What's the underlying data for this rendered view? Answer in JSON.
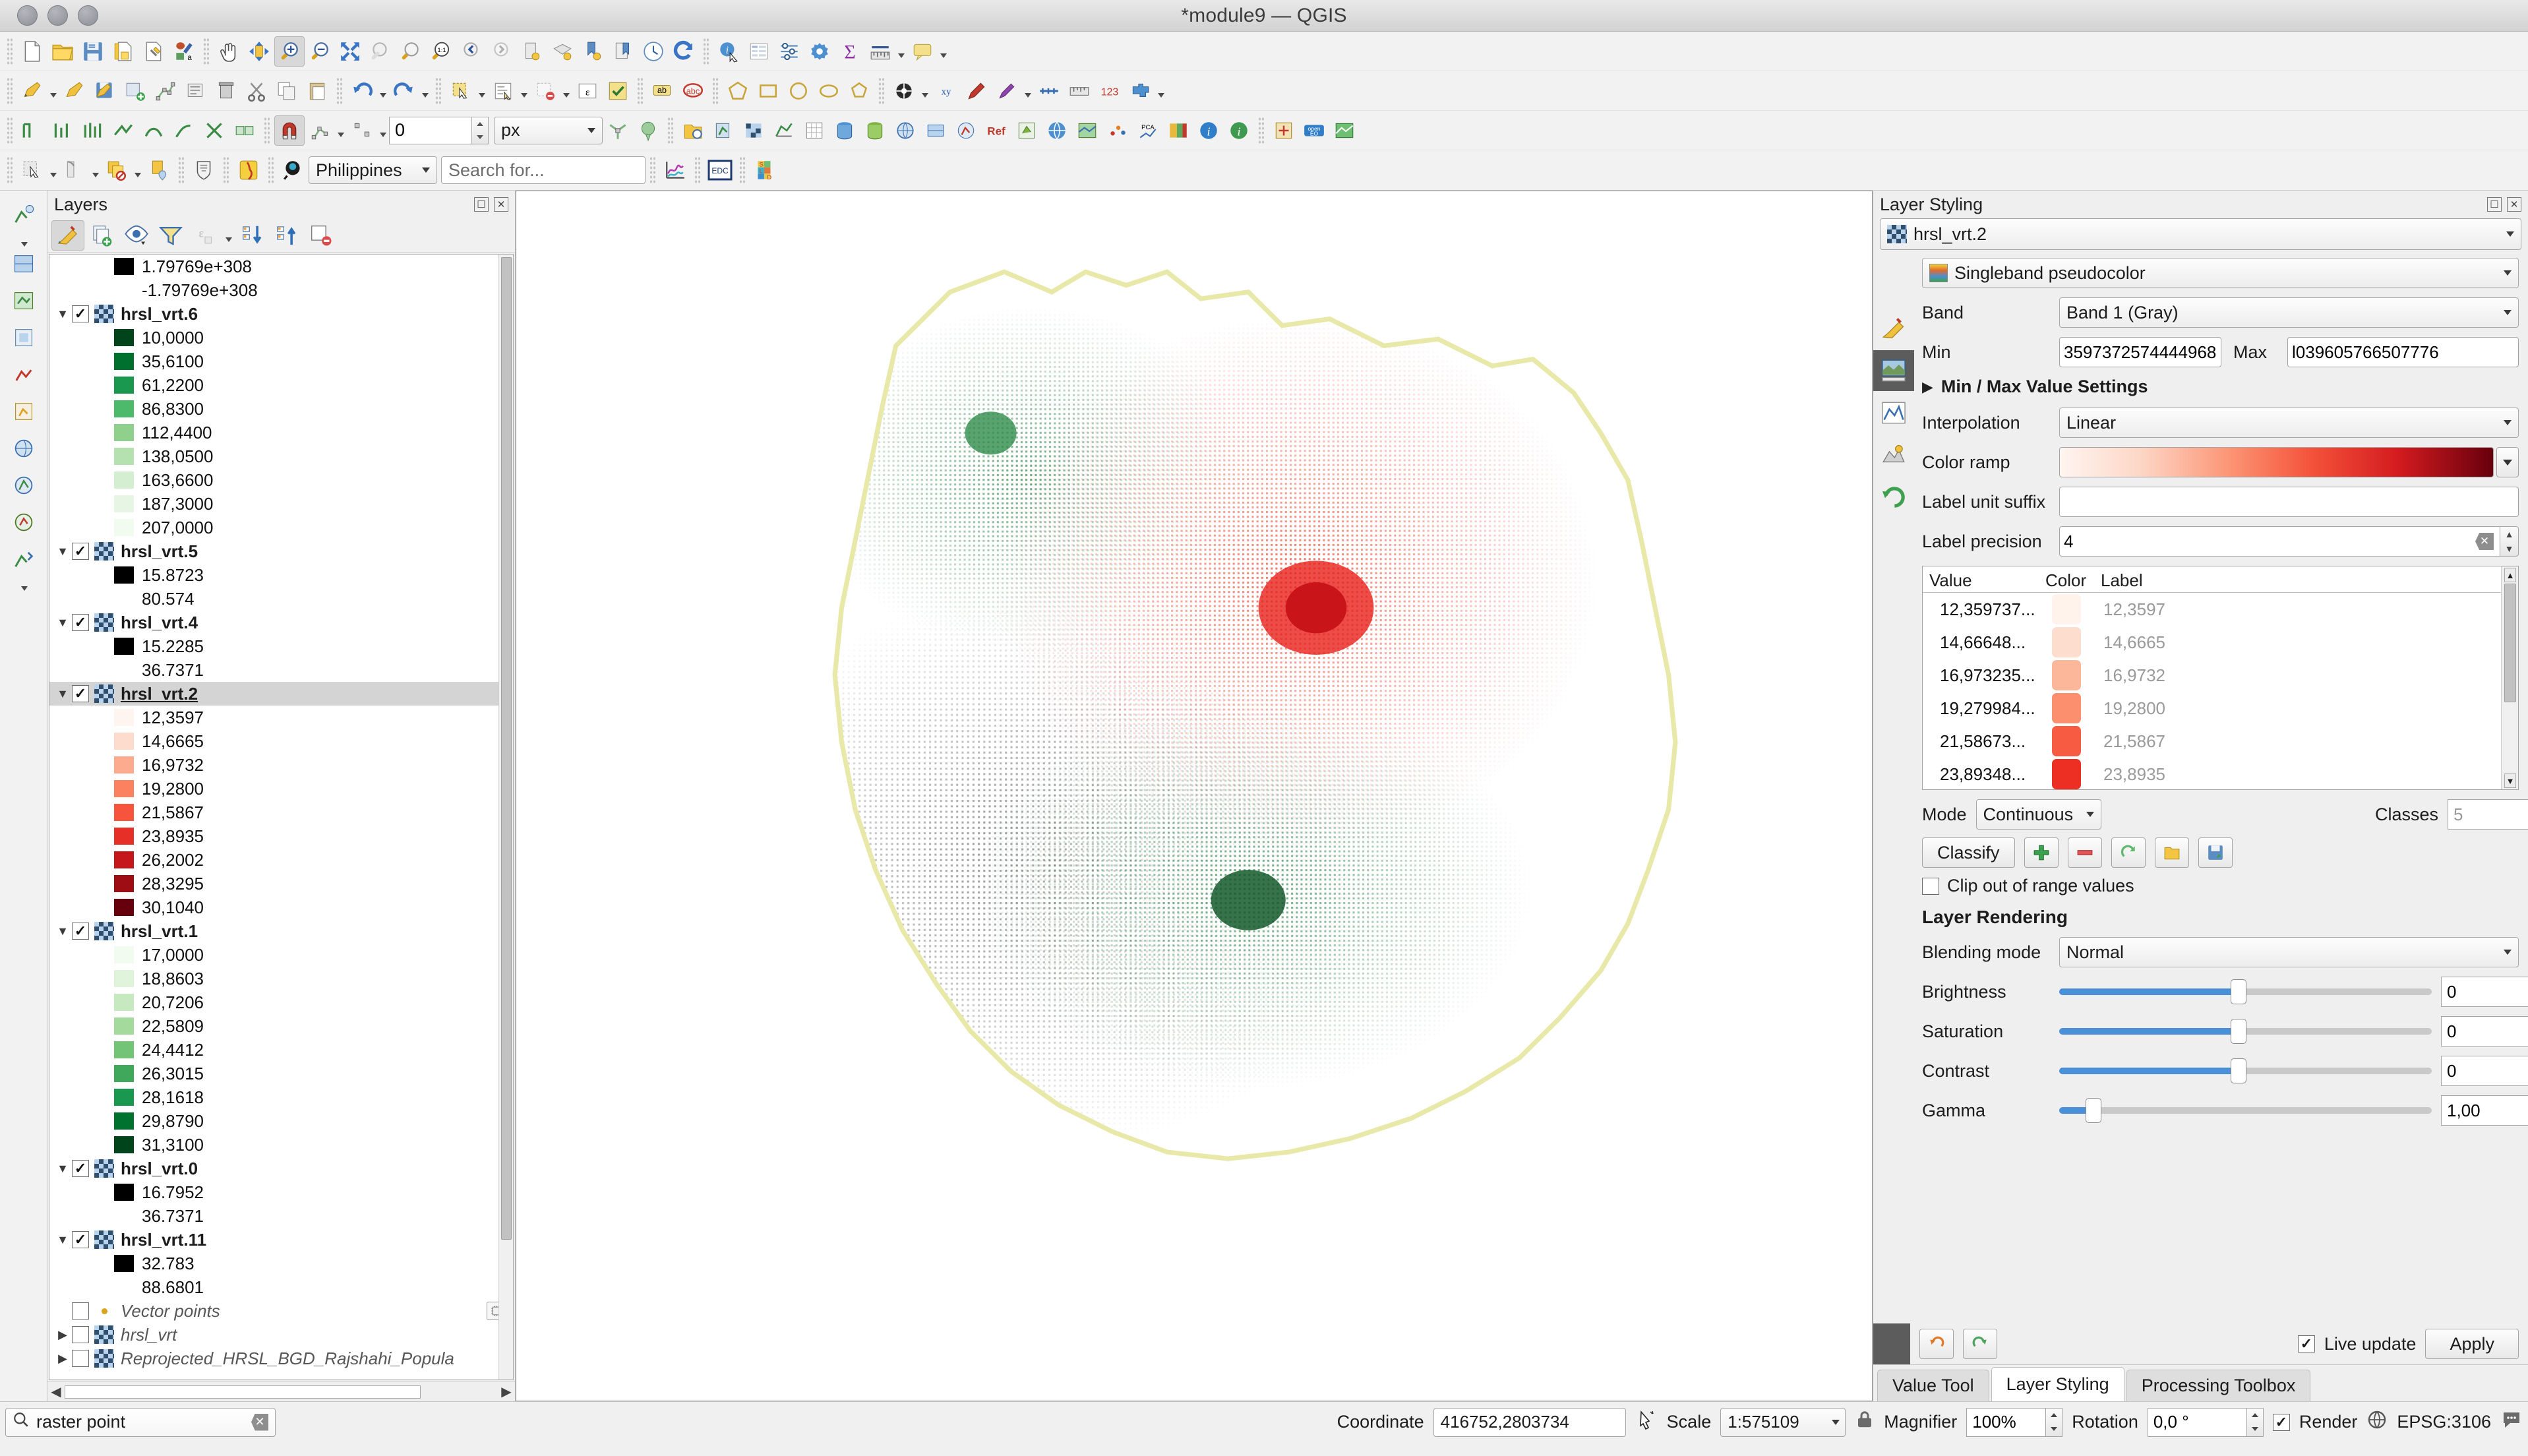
{
  "window": {
    "title": "*module9 — QGIS"
  },
  "toolbars": {
    "snapping_tolerance": "0",
    "snapping_units": "px",
    "country_combo": "Philippines",
    "search_placeholder": "Search for...",
    "edc_label": "EDC"
  },
  "layers_panel": {
    "title": "Layers",
    "toolbar_icons": [
      "open-layer-styling-panel-icon",
      "add-group-icon",
      "manage-map-themes-icon",
      "filter-legend-icon",
      "expression-filter-icon",
      "expand-all-icon",
      "collapse-all-icon",
      "remove-layer-icon"
    ],
    "items": [
      {
        "type": "legend",
        "swatch": "#000000",
        "label": "1.79769e+308"
      },
      {
        "type": "legend",
        "swatch": "",
        "label": "-1.79769e+308"
      },
      {
        "type": "layer",
        "name": "hrsl_vrt.6",
        "checked": true,
        "expanded": true,
        "selected": false
      },
      {
        "type": "legend",
        "swatch": "#00441b",
        "label": "10,0000"
      },
      {
        "type": "legend",
        "swatch": "#00702f",
        "label": "35,6100"
      },
      {
        "type": "legend",
        "swatch": "#1a9850",
        "label": "61,2200"
      },
      {
        "type": "legend",
        "swatch": "#4cb96b",
        "label": "86,8300"
      },
      {
        "type": "legend",
        "swatch": "#8ed08c",
        "label": "112,4400"
      },
      {
        "type": "legend",
        "swatch": "#b5e0b0",
        "label": "138,0500"
      },
      {
        "type": "legend",
        "swatch": "#d3eed0",
        "label": "163,6600"
      },
      {
        "type": "legend",
        "swatch": "#e7f6e4",
        "label": "187,3000"
      },
      {
        "type": "legend",
        "swatch": "#f2fbf0",
        "label": "207,0000"
      },
      {
        "type": "layer",
        "name": "hrsl_vrt.5",
        "checked": true,
        "expanded": true,
        "selected": false
      },
      {
        "type": "legend",
        "swatch": "#000000",
        "label": "15.8723"
      },
      {
        "type": "legend",
        "swatch": "",
        "label": "80.574"
      },
      {
        "type": "layer",
        "name": "hrsl_vrt.4",
        "checked": true,
        "expanded": true,
        "selected": false
      },
      {
        "type": "legend",
        "swatch": "#000000",
        "label": "15.2285"
      },
      {
        "type": "legend",
        "swatch": "",
        "label": "36.7371"
      },
      {
        "type": "layer",
        "name": "hrsl_vrt.2",
        "checked": true,
        "expanded": true,
        "selected": true
      },
      {
        "type": "legend",
        "swatch": "#fff5f0",
        "label": "12,3597"
      },
      {
        "type": "legend",
        "swatch": "#fddccd",
        "label": "14,6665"
      },
      {
        "type": "legend",
        "swatch": "#fcab8f",
        "label": "16,9732"
      },
      {
        "type": "legend",
        "swatch": "#fc8161",
        "label": "19,2800"
      },
      {
        "type": "legend",
        "swatch": "#f6543d",
        "label": "21,5867"
      },
      {
        "type": "legend",
        "swatch": "#e62f26",
        "label": "23,8935"
      },
      {
        "type": "legend",
        "swatch": "#c5161b",
        "label": "26,2002"
      },
      {
        "type": "legend",
        "swatch": "#9e0d14",
        "label": "28,3295"
      },
      {
        "type": "legend",
        "swatch": "#67000d",
        "label": "30,1040"
      },
      {
        "type": "layer",
        "name": "hrsl_vrt.1",
        "checked": true,
        "expanded": true,
        "selected": false
      },
      {
        "type": "legend",
        "swatch": "#f2fbf0",
        "label": "17,0000"
      },
      {
        "type": "legend",
        "swatch": "#e0f4dc",
        "label": "18,8603"
      },
      {
        "type": "legend",
        "swatch": "#c7e9c0",
        "label": "20,7206"
      },
      {
        "type": "legend",
        "swatch": "#a4db9c",
        "label": "22,5809"
      },
      {
        "type": "legend",
        "swatch": "#73c476",
        "label": "24,4412"
      },
      {
        "type": "legend",
        "swatch": "#3fa85a",
        "label": "26,3015"
      },
      {
        "type": "legend",
        "swatch": "#1a9850",
        "label": "28,1618"
      },
      {
        "type": "legend",
        "swatch": "#00722f",
        "label": "29,8790"
      },
      {
        "type": "legend",
        "swatch": "#00441b",
        "label": "31,3100"
      },
      {
        "type": "layer",
        "name": "hrsl_vrt.0",
        "checked": true,
        "expanded": true,
        "selected": false
      },
      {
        "type": "legend",
        "swatch": "#000000",
        "label": "16.7952"
      },
      {
        "type": "legend",
        "swatch": "",
        "label": "36.7371"
      },
      {
        "type": "layer",
        "name": "hrsl_vrt.11",
        "checked": true,
        "expanded": true,
        "selected": false
      },
      {
        "type": "legend",
        "swatch": "#000000",
        "label": "32.783"
      },
      {
        "type": "legend",
        "swatch": "",
        "label": "88.6801"
      },
      {
        "type": "vector",
        "name": "Vector points",
        "checked": false,
        "expanded": false,
        "selected": false
      },
      {
        "type": "collapsed",
        "name": "hrsl_vrt",
        "checked": false,
        "expanded": false,
        "selected": false
      },
      {
        "type": "collapsed",
        "name": "Reprojected_HRSL_BGD_Rajshahi_Popula",
        "checked": false,
        "expanded": false,
        "selected": false
      }
    ]
  },
  "styling": {
    "title": "Layer Styling",
    "layer_selector": "hrsl_vrt.2",
    "renderer": "Singleband pseudocolor",
    "band_label": "Band",
    "band_value": "Band 1 (Gray)",
    "min_label": "Min",
    "min_value": "3597372574444968",
    "max_label": "Max",
    "max_value": "l039605766507776",
    "minmax_settings": "Min / Max Value Settings",
    "interpolation_label": "Interpolation",
    "interpolation_value": "Linear",
    "color_ramp_label": "Color ramp",
    "label_unit_suffix_label": "Label unit suffix",
    "label_unit_suffix_value": "",
    "label_precision_label": "Label precision",
    "label_precision_value": "4",
    "table": {
      "headers": [
        "Value",
        "Color",
        "Label"
      ],
      "rows": [
        {
          "value": "12,359737...",
          "color": "#fff3ec",
          "label": "12,3597"
        },
        {
          "value": "14,66648...",
          "color": "#fcddce",
          "label": "14,6665"
        },
        {
          "value": "16,973235...",
          "color": "#fcb79b",
          "label": "16,9732"
        },
        {
          "value": "19,279984...",
          "color": "#fc8f6d",
          "label": "19,2800"
        },
        {
          "value": "21,58673...",
          "color": "#f75c43",
          "label": "21,5867"
        },
        {
          "value": "23,89348...",
          "color": "#ec2f22",
          "label": "23,8935"
        }
      ]
    },
    "mode_label": "Mode",
    "mode_value": "Continuous",
    "classes_label": "Classes",
    "classes_value": "5",
    "classify_label": "Classify",
    "action_icons": [
      "add-class-icon",
      "remove-class-icon",
      "reload-icon",
      "load-color-map-icon",
      "save-color-map-icon"
    ],
    "clip_label": "Clip out of range values",
    "clip_checked": false,
    "layer_rendering": "Layer Rendering",
    "blending_label": "Blending mode",
    "blending_value": "Normal",
    "brightness_label": "Brightness",
    "brightness_value": "0",
    "saturation_label": "Saturation",
    "saturation_value": "0",
    "contrast_label": "Contrast",
    "contrast_value": "0",
    "gamma_label": "Gamma",
    "gamma_value": "1,00",
    "live_update_label": "Live update",
    "live_update_checked": true,
    "apply_label": "Apply",
    "tabs": [
      {
        "label": "Value Tool",
        "active": false
      },
      {
        "label": "Layer Styling",
        "active": true
      },
      {
        "label": "Processing Toolbox",
        "active": false
      }
    ]
  },
  "status": {
    "locator_text": "raster point",
    "coordinate_label": "Coordinate",
    "coordinate_value": "416752,2803734",
    "scale_label": "Scale",
    "scale_value": "1:575109",
    "magnifier_label": "Magnifier",
    "magnifier_value": "100%",
    "rotation_label": "Rotation",
    "rotation_value": "0,0 °",
    "render_label": "Render",
    "render_checked": true,
    "crs_label": "EPSG:3106"
  }
}
